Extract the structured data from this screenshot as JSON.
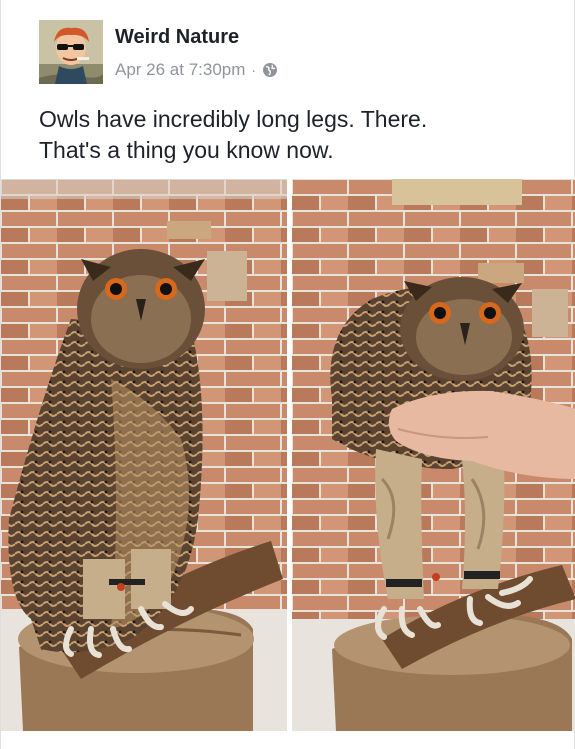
{
  "post": {
    "page_name": "Weird Nature",
    "timestamp": "Apr 26 at 7:30pm",
    "separator": "·",
    "privacy_icon": "globe-icon",
    "text_lines": [
      "Owls have incredibly long legs. There.",
      "That's a thing you know now."
    ]
  },
  "photos": [
    {
      "subject": "owl-perched-standing"
    },
    {
      "subject": "owl-wings-lifted-by-hand"
    }
  ],
  "colors": {
    "page_name": "#1d2129",
    "meta_text": "#90949c",
    "post_text": "#1d2129",
    "brick": "#c98e6f",
    "owl_feathers": "#5a4330"
  }
}
